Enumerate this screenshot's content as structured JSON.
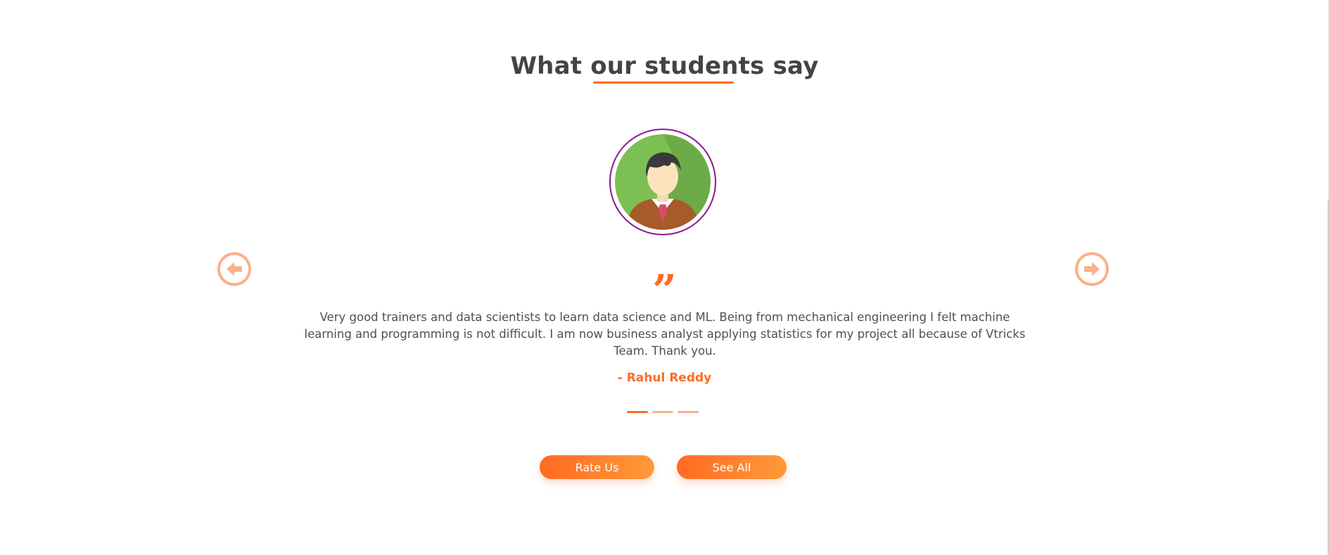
{
  "section": {
    "heading": "What our students say",
    "accent_color": "#ff6b22"
  },
  "testimonial": {
    "avatar": "student-avatar-illustration",
    "quote_icon": "quote-icon",
    "quote_glyph": "”",
    "text": "Very good trainers and data scientists to learn data science and ML. Being from mechanical engineering I felt machine learning and programming is not difficult. I am now business analyst applying statistics for my project all because of Vtricks Team. Thank you.",
    "author": "- Rahul Reddy"
  },
  "carousel": {
    "prev_icon": "arrow-left-circle-icon",
    "next_icon": "arrow-right-circle-icon",
    "slide_count": 3,
    "active_index": 0
  },
  "buttons": {
    "rate_label": "Rate Us",
    "see_all_label": "See All"
  }
}
